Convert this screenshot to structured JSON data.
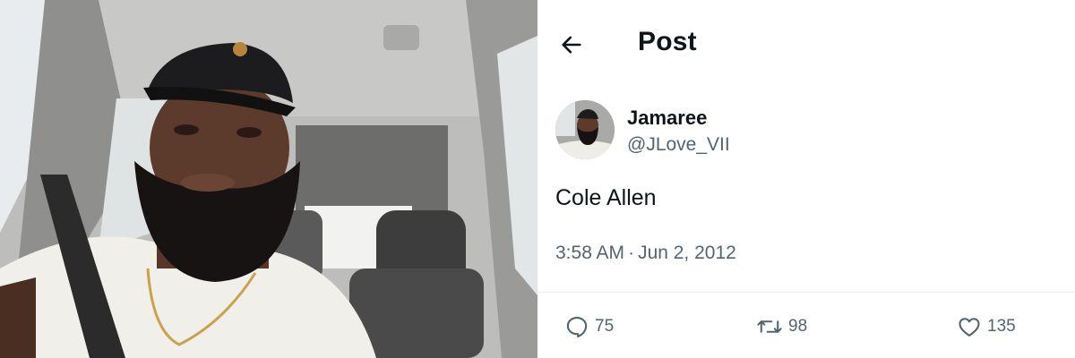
{
  "photo": {
    "subject": ""
  },
  "header": {
    "title": "Post"
  },
  "author": {
    "display_name": "Jamaree",
    "handle": "@JLove_VII"
  },
  "post": {
    "text": "Cole Allen",
    "time": "3:58 AM",
    "separator": "·",
    "date": "Jun 2, 2012"
  },
  "actions": {
    "reply": {
      "icon": "reply-icon",
      "count": "75"
    },
    "repost": {
      "icon": "repost-icon",
      "count": "98"
    },
    "like": {
      "icon": "heart-icon",
      "count": "135"
    }
  },
  "colors": {
    "primary_text": "#0f1419",
    "secondary_text": "#536471",
    "divider": "#eff3f4"
  }
}
